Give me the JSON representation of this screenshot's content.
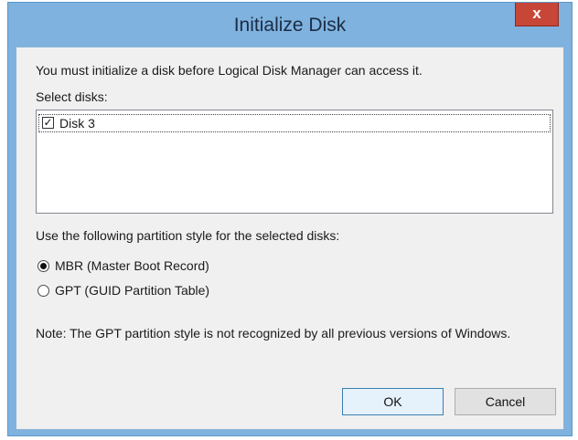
{
  "window": {
    "title": "Initialize Disk",
    "close_glyph": "x"
  },
  "dialog": {
    "intro": "You must initialize a disk before Logical Disk Manager can access it.",
    "select_disks_label": "Select disks:",
    "disks": [
      {
        "label": "Disk 3",
        "checked": true
      }
    ],
    "partition_style_label": "Use the following partition style for the selected disks:",
    "partition_styles": [
      {
        "label": "MBR (Master Boot Record)",
        "selected": true
      },
      {
        "label": "GPT (GUID Partition Table)",
        "selected": false
      }
    ],
    "note": "Note: The GPT partition style is not recognized by all previous versions of Windows."
  },
  "buttons": {
    "ok": "OK",
    "cancel": "Cancel"
  },
  "colors": {
    "titlebar": "#7fb2de",
    "close_button": "#c74638",
    "dialog_background": "#f0f0f0"
  }
}
